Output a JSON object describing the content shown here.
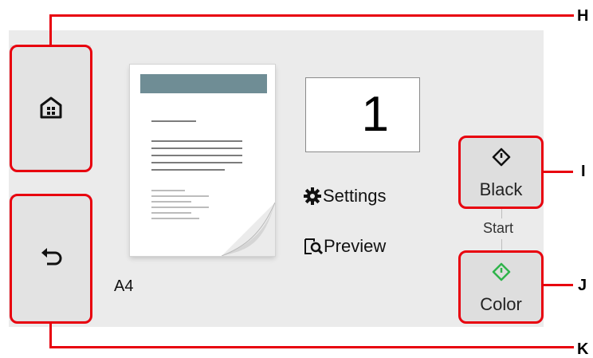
{
  "screen": {
    "copies": "1",
    "paper_size": "A4",
    "settings_label": "Settings",
    "preview_label": "Preview",
    "start_caption": "Start",
    "black_label": "Black",
    "color_label": "Color"
  },
  "nav": {
    "home_icon": "home-icon",
    "back_icon": "back-arrow-icon"
  },
  "callouts": {
    "h": "H",
    "i": "I",
    "j": "J",
    "k": "K"
  },
  "colors": {
    "callout_red": "#e8000e",
    "panel_gray": "#ebebeb",
    "color_start_green": "#2fb44b",
    "doc_band": "#6f8d95"
  }
}
